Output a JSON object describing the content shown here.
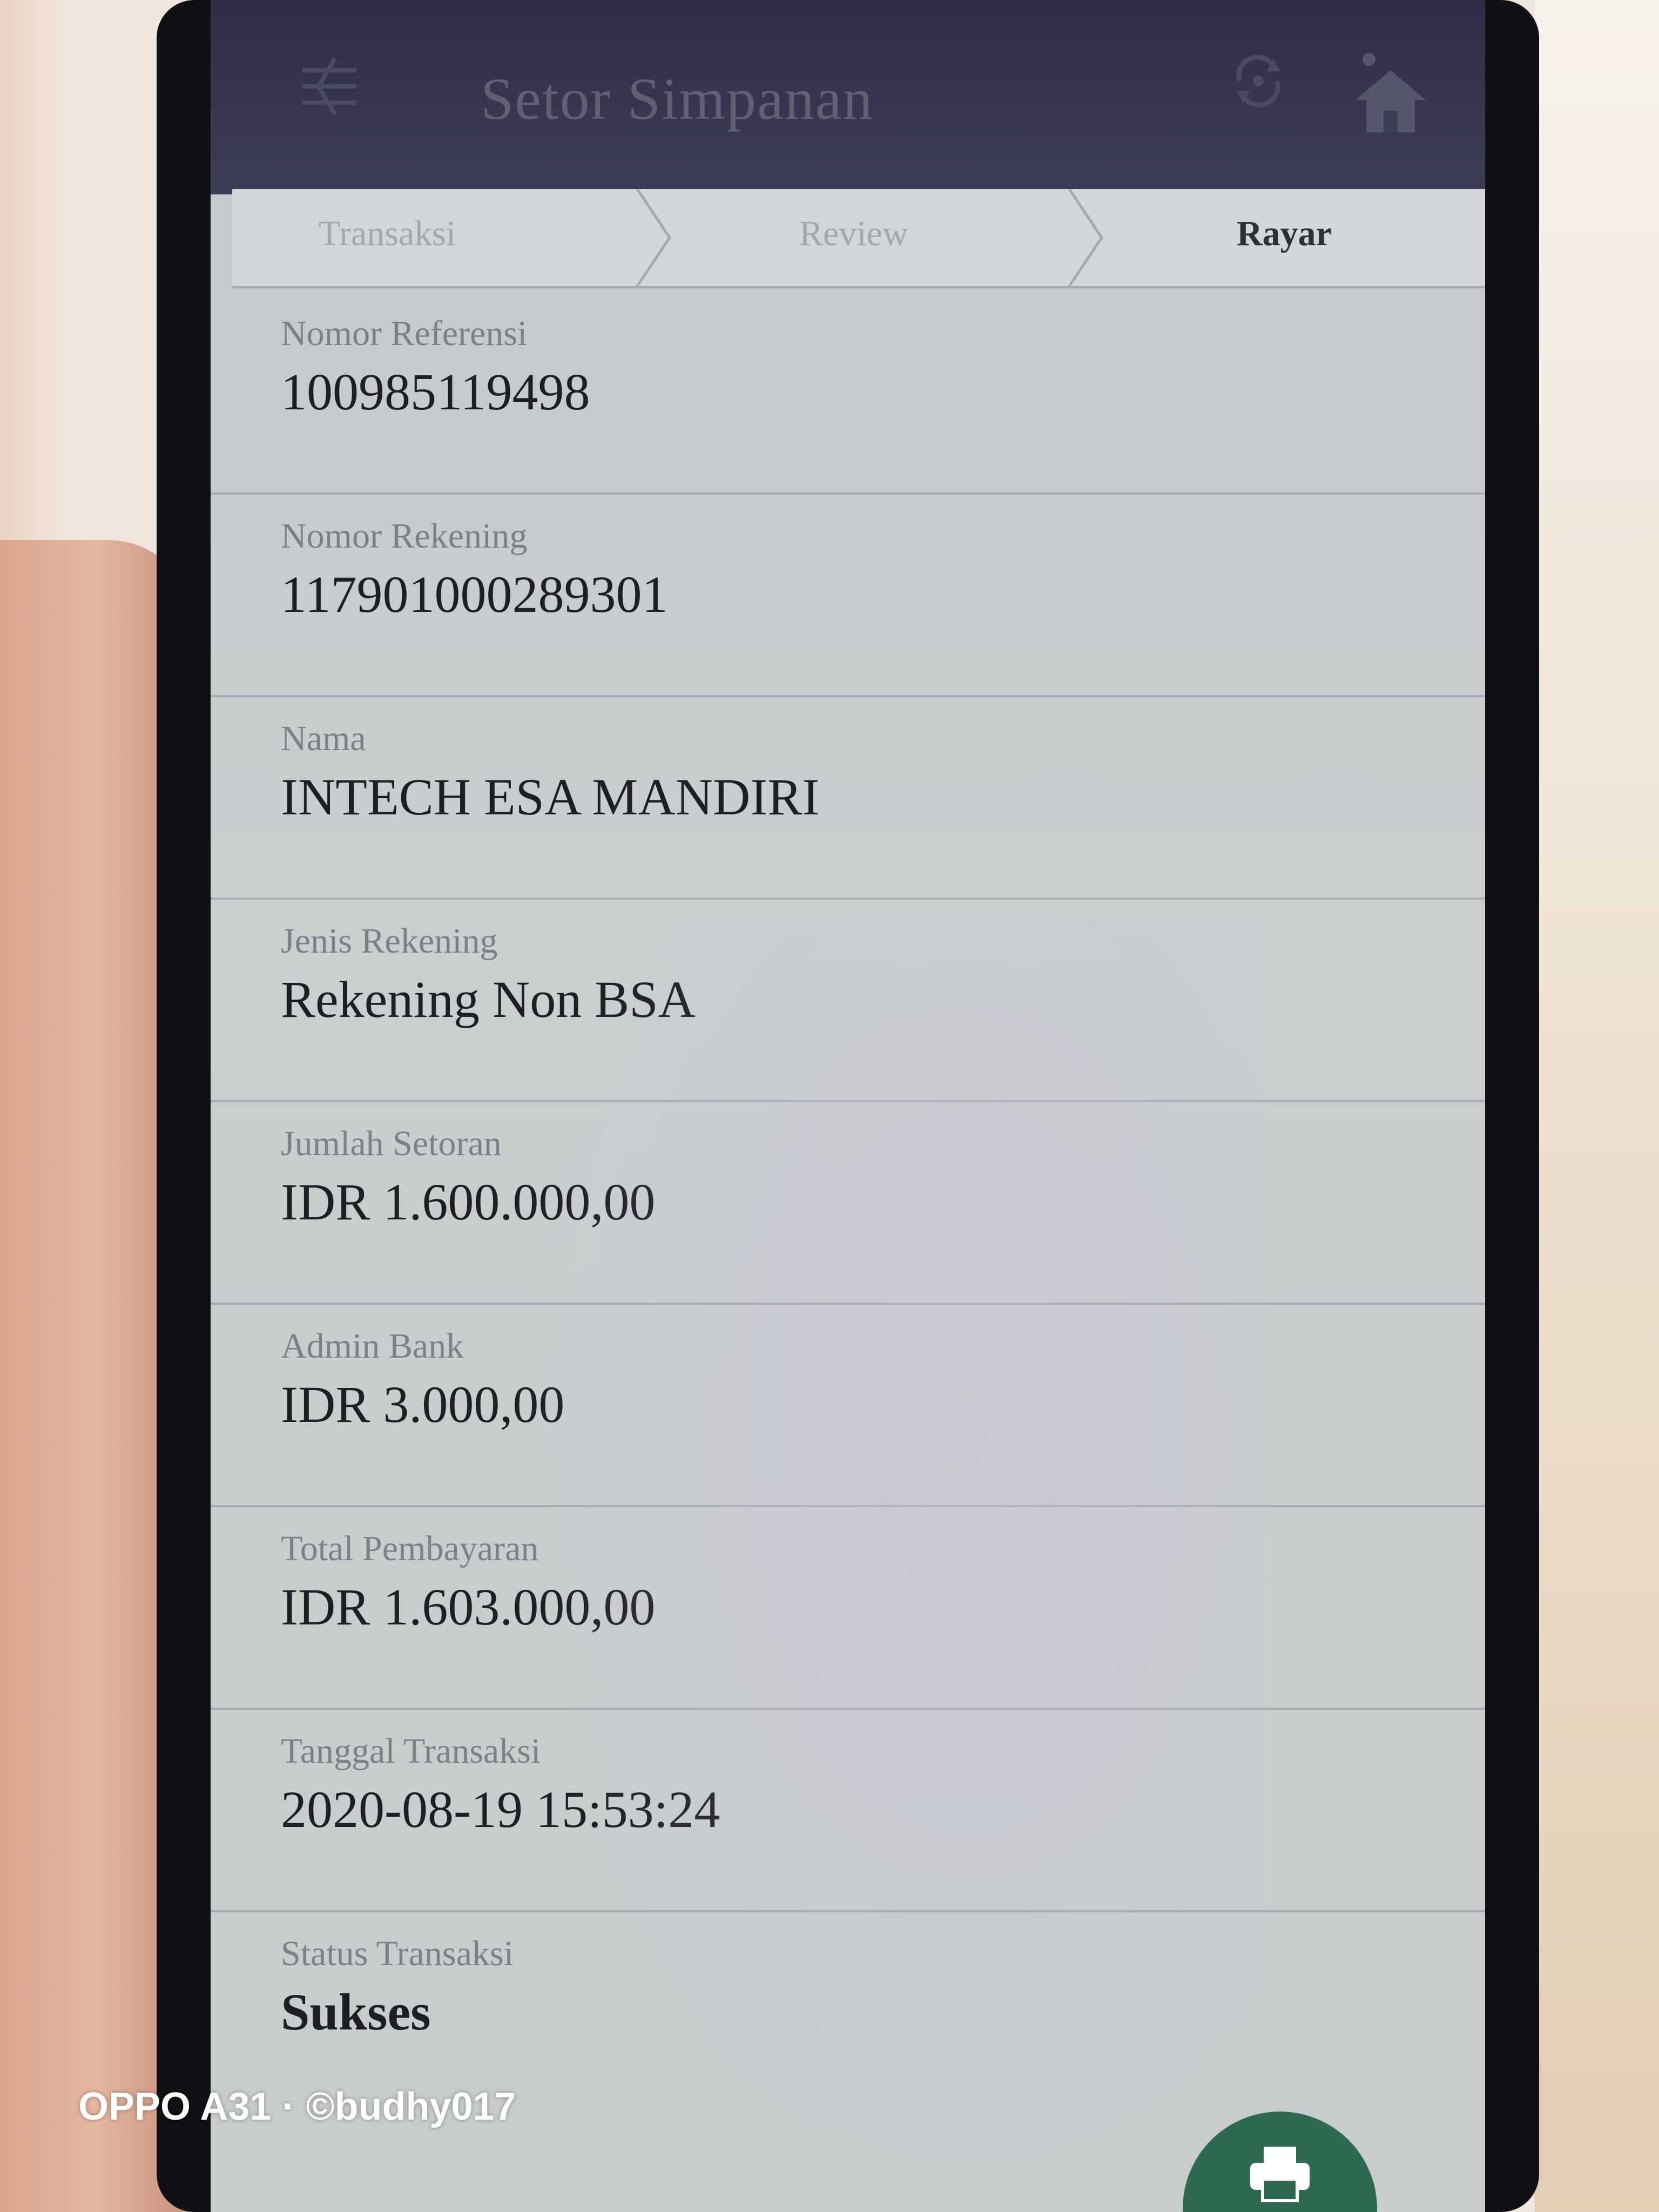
{
  "app_bar": {
    "title": "Setor Simpanan",
    "menu_icon": "menu-back-icon",
    "refresh_icon": "refresh-icon",
    "home_icon": "home-icon"
  },
  "stepper": {
    "steps": [
      {
        "label": "Transaksi",
        "active": false
      },
      {
        "label": "Review",
        "active": false
      },
      {
        "label": "Rayar",
        "active": true
      }
    ]
  },
  "fields": [
    {
      "label": "Nomor Referensi",
      "value": "100985119498"
    },
    {
      "label": "Nomor Rekening",
      "value": "117901000289301"
    },
    {
      "label": "Nama",
      "value": "INTECH ESA MANDIRI"
    },
    {
      "label": "Jenis Rekening",
      "value": "Rekening Non BSA"
    },
    {
      "label": "Jumlah Setoran",
      "value": "IDR 1.600.000,00"
    },
    {
      "label": "Admin Bank",
      "value": "IDR 3.000,00"
    },
    {
      "label": "Total Pembayaran",
      "value": "IDR 1.603.000,00"
    },
    {
      "label": "Tanggal Transaksi",
      "value": "2020-08-19 15:53:24"
    },
    {
      "label": "Status Transaksi",
      "value": "Sukses"
    }
  ],
  "fab": {
    "icon": "print-icon",
    "color": "#2e6a52"
  },
  "watermark": "OPPO A31 · ©budhy017",
  "colors": {
    "app_bar": "#2f2c46",
    "screen_bg": "#c7cccd",
    "text_dark": "#1e1f24",
    "label_gray": "#7b8186"
  }
}
